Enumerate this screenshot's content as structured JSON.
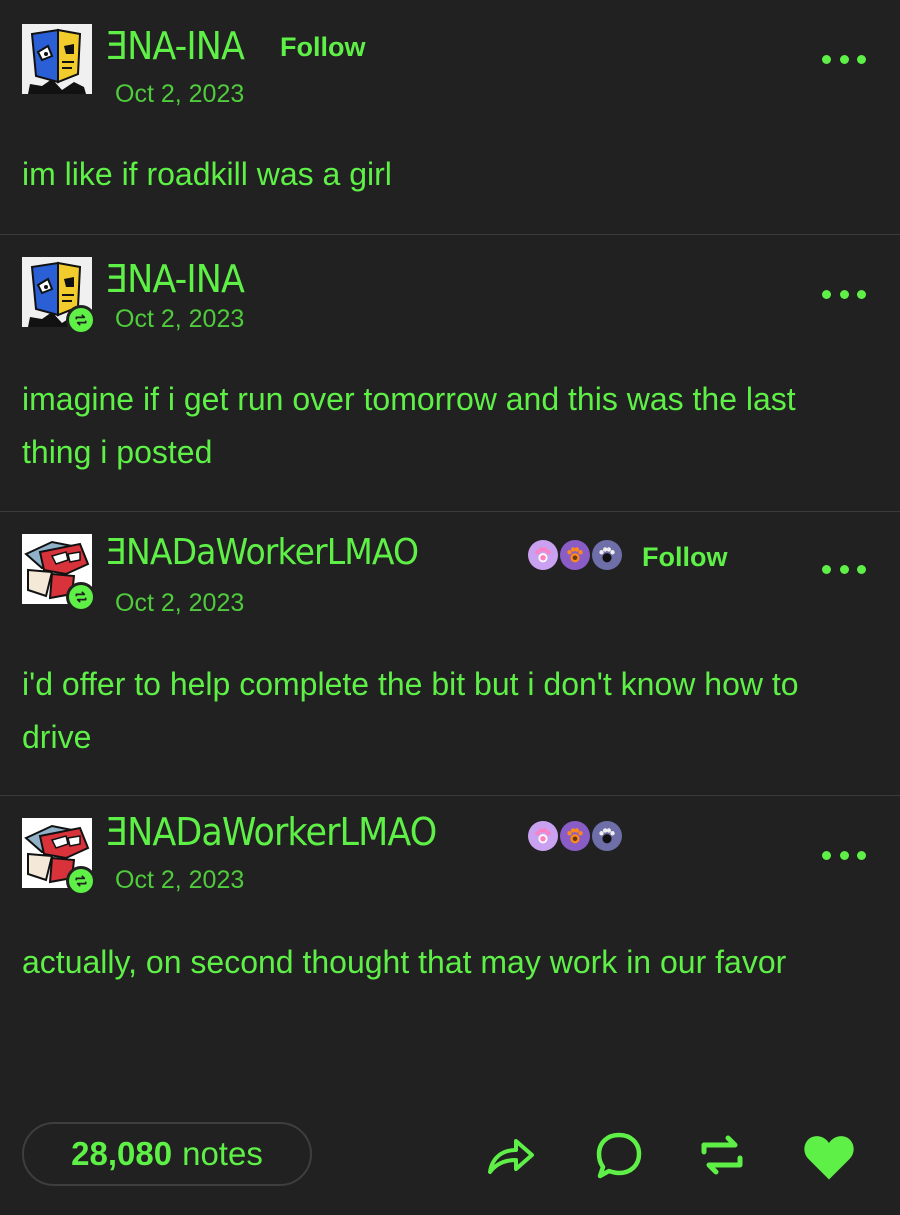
{
  "posts": [
    {
      "username": "ƎNA-INA",
      "follow_label": "Follow",
      "date": "Oct 2, 2023",
      "text": "im like if roadkill was a girl"
    },
    {
      "username": "ƎNA-INA",
      "date": "Oct 2, 2023",
      "text": "imagine if i get run over tomorrow and this was the last thing i posted"
    },
    {
      "username": "ƎNADaWorkerLMAO",
      "follow_label": "Follow",
      "date": "Oct 2, 2023",
      "text": "i'd offer to help complete the bit but i don't know how to drive",
      "badges": [
        "pink-paw-icon",
        "orange-paw-icon",
        "black-paw-icon"
      ]
    },
    {
      "username": "ƎNADaWorkerLMAO",
      "date": "Oct 2, 2023",
      "text": "actually, on second thought that may work in our favor",
      "badges": [
        "pink-paw-icon",
        "orange-paw-icon",
        "black-paw-icon"
      ]
    }
  ],
  "footer": {
    "notes_count": "28,080",
    "notes_label": "notes",
    "actions": [
      "share-icon",
      "reply-icon",
      "reblog-icon",
      "like-icon"
    ]
  },
  "colors": {
    "background": "#212121",
    "accent": "#5ef047",
    "divider": "#3a3a3a"
  }
}
